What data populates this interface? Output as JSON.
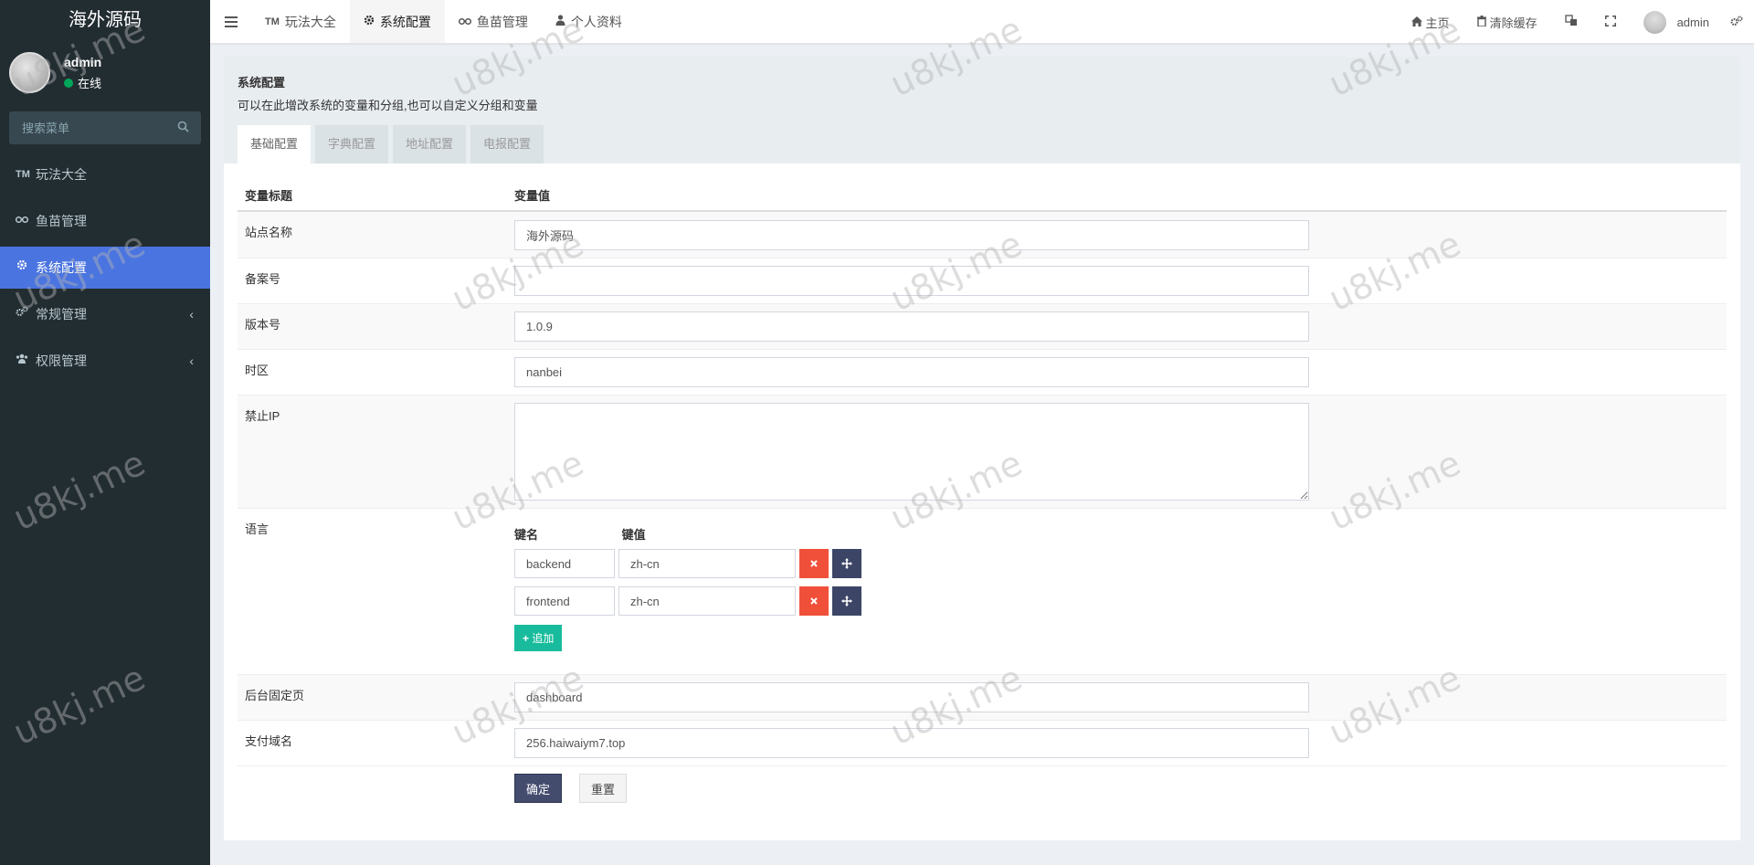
{
  "app": {
    "logo": "海外源码"
  },
  "user": {
    "name": "admin",
    "status": "在线"
  },
  "sidebar": {
    "search_placeholder": "搜索菜单",
    "items": [
      {
        "icon": "TM",
        "label": "玩法大全"
      },
      {
        "icon": "binoculars-icon",
        "label": "鱼苗管理"
      },
      {
        "icon": "gear-icon",
        "label": "系统配置",
        "active": true
      },
      {
        "icon": "gears-icon",
        "label": "常规管理",
        "arrow": "‹"
      },
      {
        "icon": "users-icon",
        "label": "权限管理",
        "arrow": "‹"
      }
    ]
  },
  "topnav": {
    "tabs": [
      {
        "icon": "TM",
        "label": "玩法大全"
      },
      {
        "icon": "gear-icon",
        "label": "系统配置",
        "active": true
      },
      {
        "icon": "binoculars-icon",
        "label": "鱼苗管理"
      },
      {
        "icon": "user-icon",
        "label": "个人资料"
      }
    ],
    "home": "主页",
    "clear_cache": "清除缓存",
    "username": "admin"
  },
  "panel": {
    "title": "系统配置",
    "description": "可以在此增改系统的变量和分组,也可以自定义分组和变量",
    "tabs": [
      "基础配置",
      "字典配置",
      "地址配置",
      "电报配置"
    ]
  },
  "table": {
    "head_title": "变量标题",
    "head_value": "变量值",
    "site_name_label": "站点名称",
    "site_name_value": "海外源码",
    "beian_label": "备案号",
    "beian_value": "",
    "version_label": "版本号",
    "version_value": "1.0.9",
    "timezone_label": "时区",
    "timezone_value": "nanbei",
    "ban_ip_label": "禁止IP",
    "ban_ip_value": "",
    "language_label": "语言",
    "key_name_head": "键名",
    "key_value_head": "键值",
    "language_rows": [
      {
        "key": "backend",
        "value": "zh-cn"
      },
      {
        "key": "frontend",
        "value": "zh-cn"
      }
    ],
    "add_label": "追加",
    "fixed_page_label": "后台固定页",
    "fixed_page_value": "dashboard",
    "pay_domain_label": "支付域名",
    "pay_domain_value": "256.haiwaiym7.top",
    "ok_label": "确定",
    "reset_label": "重置"
  },
  "watermark": "u8kj.me"
}
